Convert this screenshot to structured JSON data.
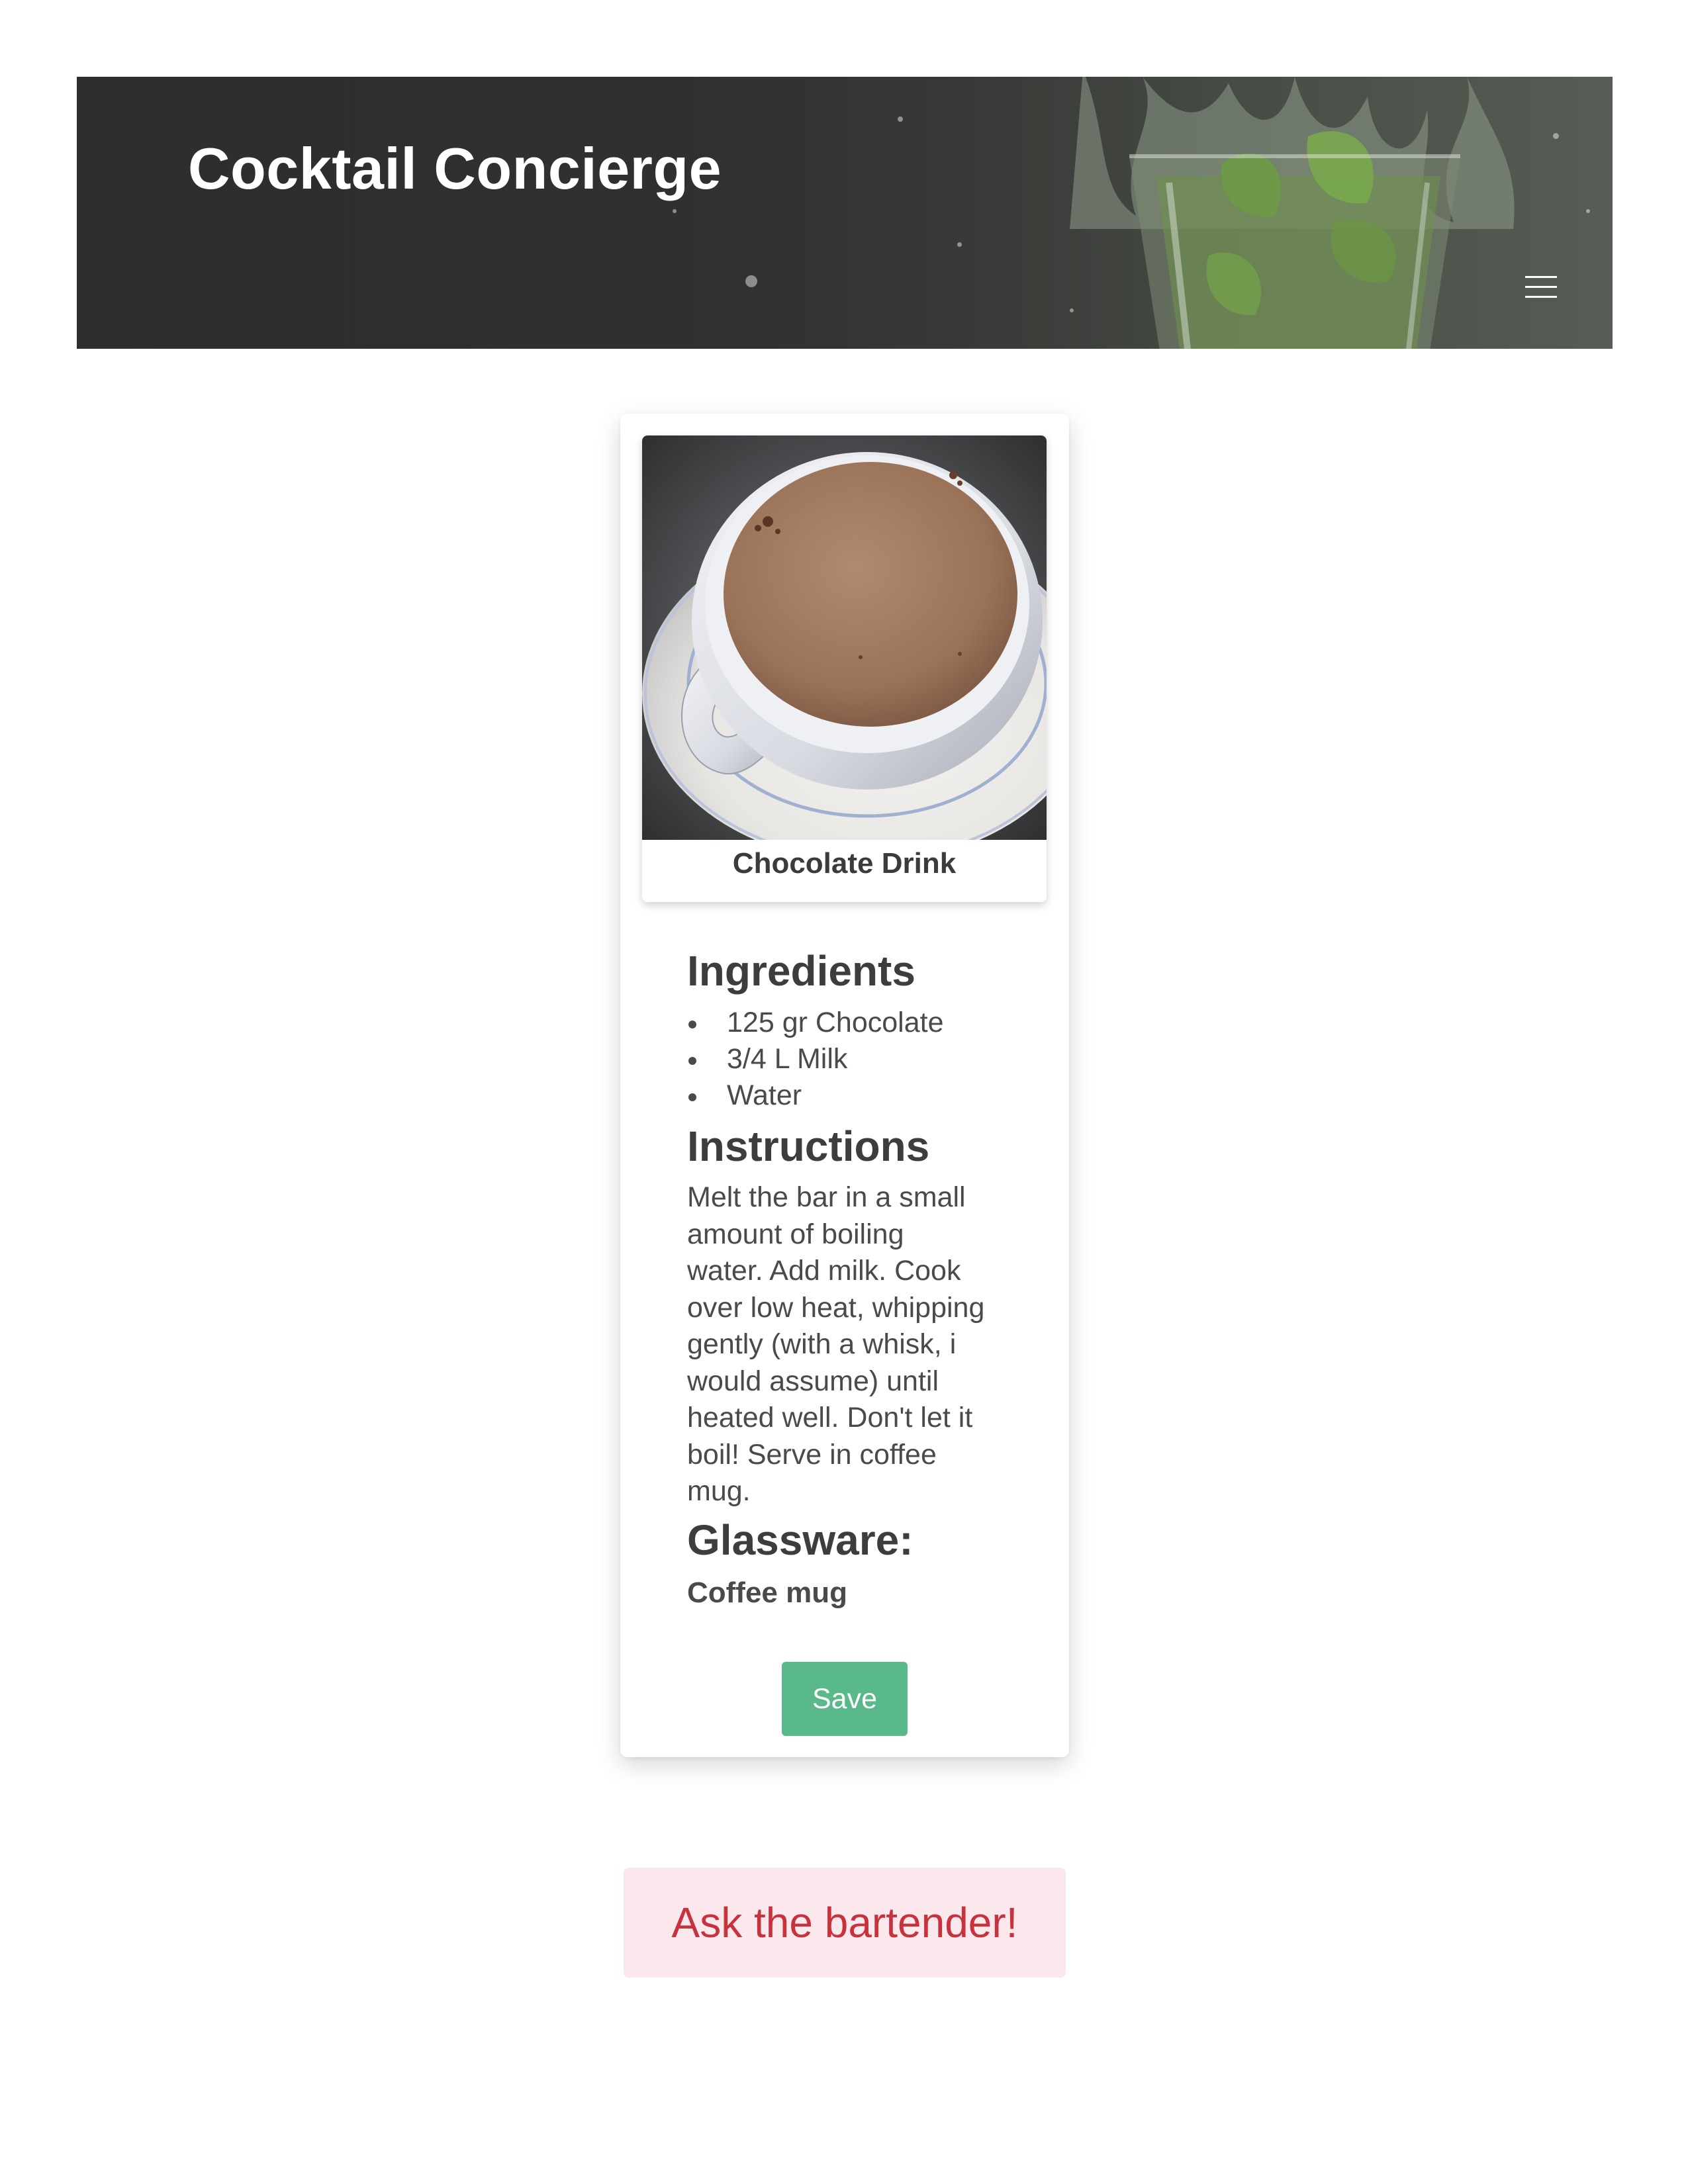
{
  "header": {
    "brand": "Cocktail Concierge",
    "menu_icon": "hamburger-menu-icon"
  },
  "drink": {
    "name": "Chocolate Drink",
    "image": "hot-chocolate-cup-photo",
    "ingredients_title": "Ingredients",
    "ingredients": [
      "125 gr Chocolate",
      "3/4 L Milk",
      "Water"
    ],
    "instructions_title": "Instructions",
    "instructions_lines": [
      "Melt the bar in a small",
      "amount of boiling",
      "water. Add milk. Cook",
      "over low heat, whipping",
      "gently (with a whisk, i",
      "would assume) until",
      "heated well. Don't let it",
      "boil! Serve in coffee",
      "mug."
    ],
    "glassware_title": "Glassware:",
    "glassware": "Coffee mug",
    "save_label": "Save"
  },
  "ask_label": "Ask the bartender!",
  "colors": {
    "header_dark": "#2d2d2d",
    "save_green": "#5ab98b",
    "ask_background": "#fae8ec",
    "ask_text": "#c8323d"
  }
}
